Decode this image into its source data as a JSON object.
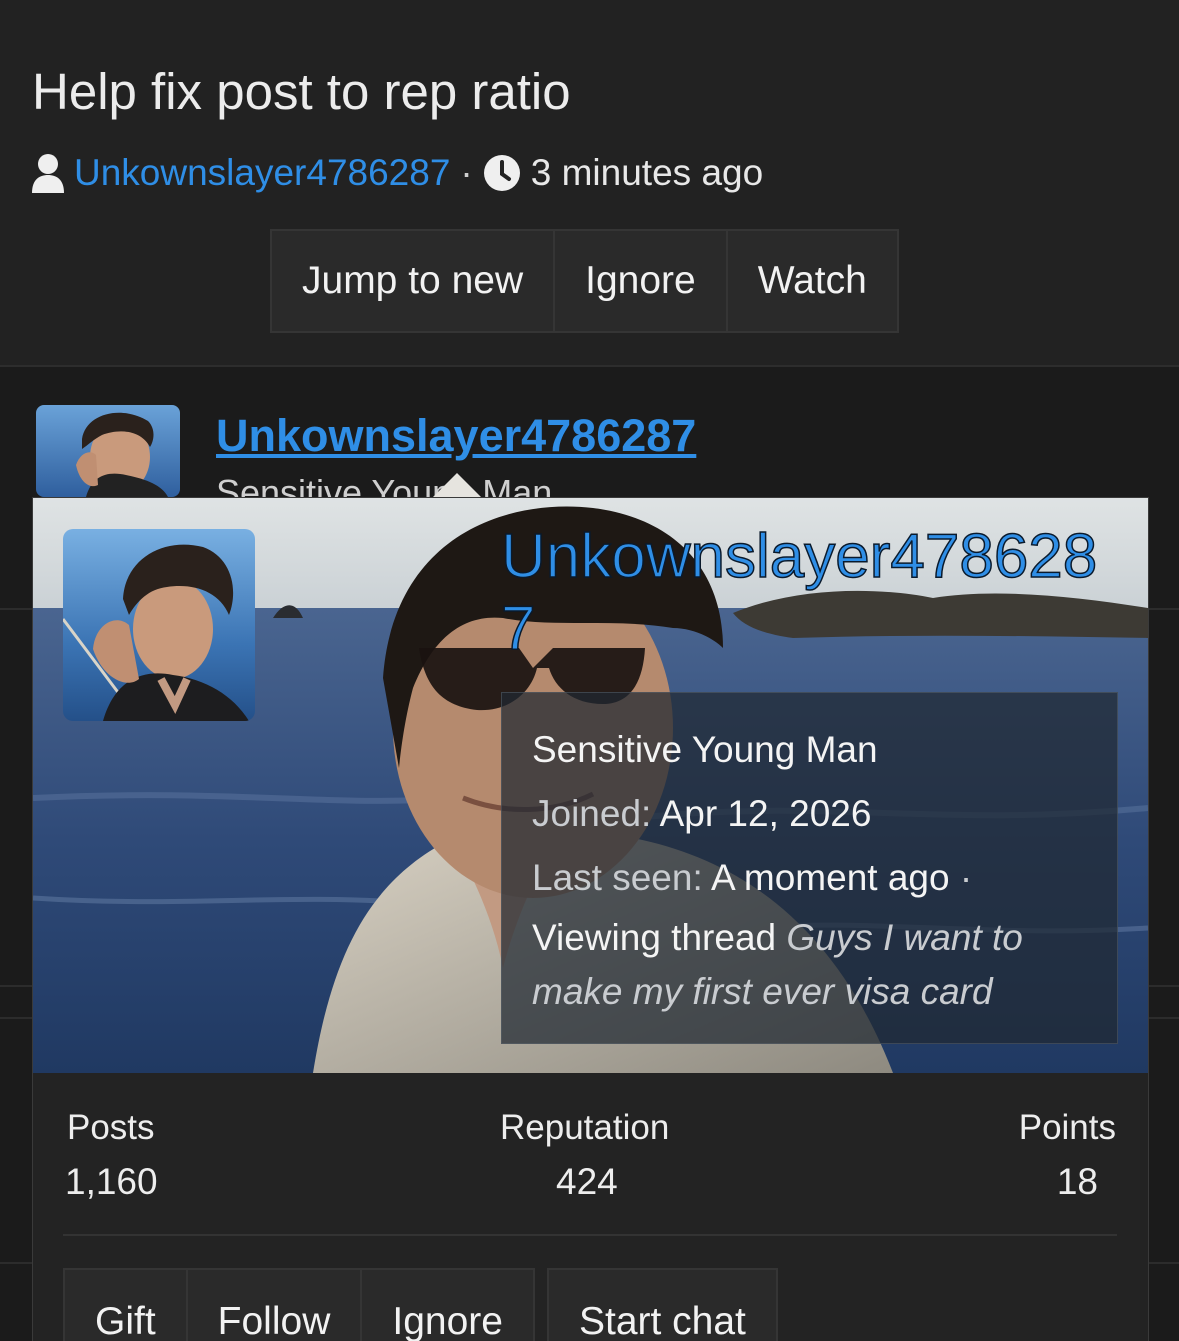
{
  "thread": {
    "title": "Help fix post to rep ratio",
    "author": "Unkownslayer4786287",
    "separator": "·",
    "time": "3 minutes ago",
    "icons": {
      "author": "user-icon",
      "time": "clock-icon"
    }
  },
  "thread_actions": [
    "Jump to new",
    "Ignore",
    "Watch"
  ],
  "post": {
    "username": "Unkownslayer4786287"
  },
  "member_card": {
    "username": "Unkownslayer4786287",
    "user_title": "Sensitive Young Man",
    "joined_label": "Joined:",
    "joined_value": "Apr 12, 2026",
    "last_seen_label": "Last seen:",
    "last_seen_value": "A moment ago",
    "separator": "·",
    "activity_prefix": "Viewing thread",
    "activity_thread": "Guys I want to make my first ever visa card",
    "stats": {
      "posts_label": "Posts",
      "posts_value": "1,160",
      "reputation_label": "Reputation",
      "reputation_value": "424",
      "points_label": "Points",
      "points_value": "18"
    },
    "actions": [
      "Gift",
      "Follow",
      "Ignore",
      "Start chat"
    ]
  },
  "colors": {
    "link": "#2f8ee6",
    "background": "#1b1b1b",
    "header": "#222222"
  }
}
